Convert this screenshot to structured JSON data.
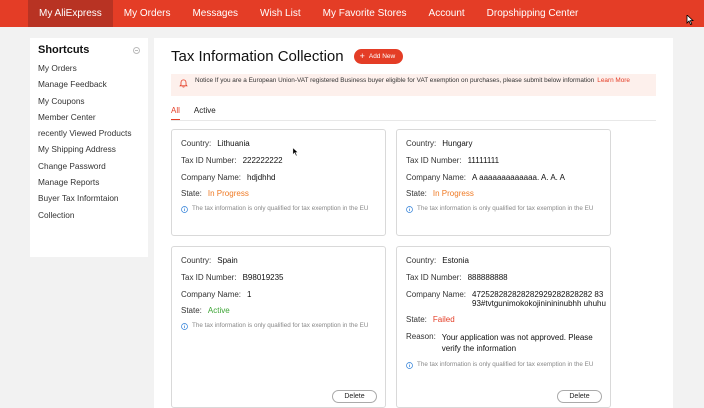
{
  "nav": {
    "items": [
      {
        "label": "My AliExpress",
        "active": true
      },
      {
        "label": "My Orders",
        "active": false
      },
      {
        "label": "Messages",
        "active": false
      },
      {
        "label": "Wish List",
        "active": false
      },
      {
        "label": "My Favorite Stores",
        "active": false
      },
      {
        "label": "Account",
        "active": false
      },
      {
        "label": "Dropshipping Center",
        "active": false
      }
    ]
  },
  "sidebar": {
    "title": "Shortcuts",
    "items": [
      "My Orders",
      "Manage Feedback",
      "My Coupons",
      "Member Center",
      "recently Viewed Products",
      "My Shipping Address",
      "Change Password",
      "Manage Reports",
      "Buyer Tax Informtaion",
      "Collection"
    ]
  },
  "main": {
    "title": "Tax Information Collection",
    "add_button": "Add New",
    "notice": {
      "text": "Notice If you are a European Union-VAT registered Business buyer eligible for VAT exemption on purchases, please submit below information",
      "link": "Learn More"
    },
    "tabs": [
      {
        "label": "All",
        "active": true
      },
      {
        "label": "Active",
        "active": false
      }
    ],
    "labels": {
      "country": "Country:",
      "tax_id": "Tax ID Number:",
      "company": "Company Name:",
      "state": "State:",
      "reason": "Reason:"
    },
    "hint": "The tax information is only qualified for tax exemption in the EU",
    "delete_label": "Delete",
    "cards": [
      {
        "country": "Lithuania",
        "tax_id": "222222222",
        "company": "hdjdhhd",
        "state": "In Progress"
      },
      {
        "country": "Hungary",
        "tax_id": "11111111",
        "company": "A aaaaaaaaaaaaa. A. A. A",
        "state": "In Progress"
      },
      {
        "country": "Spain",
        "tax_id": "B98019235",
        "company": "1",
        "state": "Active"
      },
      {
        "country": "Estonia",
        "tax_id": "888888888",
        "company": "472528282828282929282828282 8393#tvtgunimokokojininininubhh uhuhu",
        "state": "Failed",
        "reason": "Your application was not approved. Please verify the information"
      }
    ]
  },
  "colors": {
    "brand": "#e43d26",
    "progress": "#ef7a24",
    "active": "#3da435",
    "failed": "#e43d26"
  }
}
